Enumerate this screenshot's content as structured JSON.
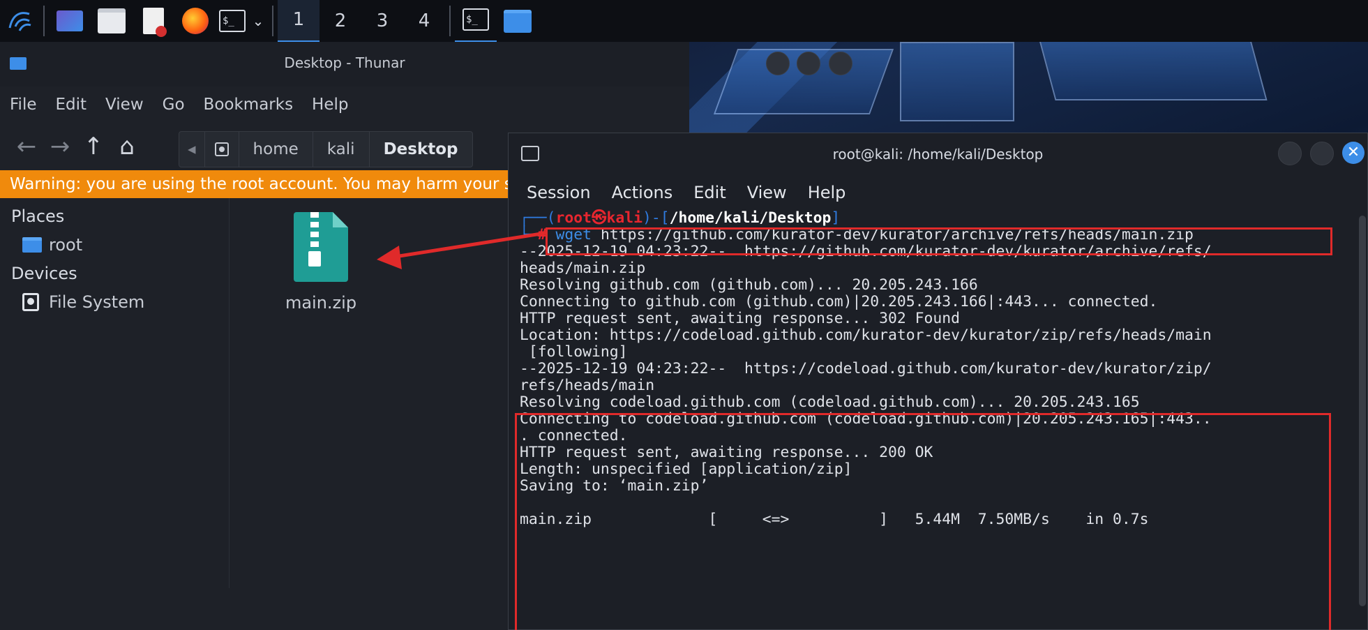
{
  "taskbar": {
    "workspaces": [
      "1",
      "2",
      "3",
      "4"
    ],
    "icons": [
      "kali-menu-icon",
      "window-list-icon",
      "file-manager-icon",
      "text-editor-icon",
      "firefox-icon",
      "terminal-icon",
      "dropdown-chevron-icon",
      "terminal-active-icon",
      "folder-icon"
    ]
  },
  "thunar": {
    "title": "Desktop - Thunar",
    "menu": [
      "File",
      "Edit",
      "View",
      "Go",
      "Bookmarks",
      "Help"
    ],
    "path": [
      "home",
      "kali",
      "Desktop"
    ],
    "warning": "Warning: you are using the root account. You may harm your system.",
    "sidebar": {
      "places_heading": "Places",
      "places": [
        {
          "label": "root",
          "icon": "folder-icon"
        }
      ],
      "devices_heading": "Devices",
      "devices": [
        {
          "label": "File System",
          "icon": "drive-icon"
        }
      ]
    },
    "files": [
      {
        "name": "main.zip",
        "icon": "zip-archive-icon"
      }
    ]
  },
  "terminal": {
    "title": "root@kali: /home/kali/Desktop",
    "menu": [
      "Session",
      "Actions",
      "Edit",
      "View",
      "Help"
    ],
    "prompt": {
      "user": "root",
      "host": "kali",
      "path": "/home/kali/Desktop"
    },
    "command": {
      "name": "wget",
      "args": "https://github.com/kurator-dev/kurator/archive/refs/heads/main.zip"
    },
    "output": [
      "--2025-12-19 04:23:22--  https://github.com/kurator-dev/kurator/archive/refs/",
      "heads/main.zip",
      "Resolving github.com (github.com)... 20.205.243.166",
      "Connecting to github.com (github.com)|20.205.243.166|:443... connected.",
      "HTTP request sent, awaiting response... 302 Found",
      "Location: https://codeload.github.com/kurator-dev/kurator/zip/refs/heads/main",
      " [following]",
      "--2025-12-19 04:23:22--  https://codeload.github.com/kurator-dev/kurator/zip/",
      "refs/heads/main",
      "Resolving codeload.github.com (codeload.github.com)... 20.205.243.165",
      "Connecting to codeload.github.com (codeload.github.com)|20.205.243.165|:443..",
      ". connected.",
      "HTTP request sent, awaiting response... 200 OK",
      "Length: unspecified [application/zip]",
      "Saving to: ‘main.zip’",
      "",
      "main.zip             [     <=>          ]   5.44M  7.50MB/s    in 0.7s"
    ]
  },
  "annotation_colors": {
    "highlight": "#e02a2a",
    "accent": "#3d8ee8",
    "warning": "#f08a0c"
  }
}
